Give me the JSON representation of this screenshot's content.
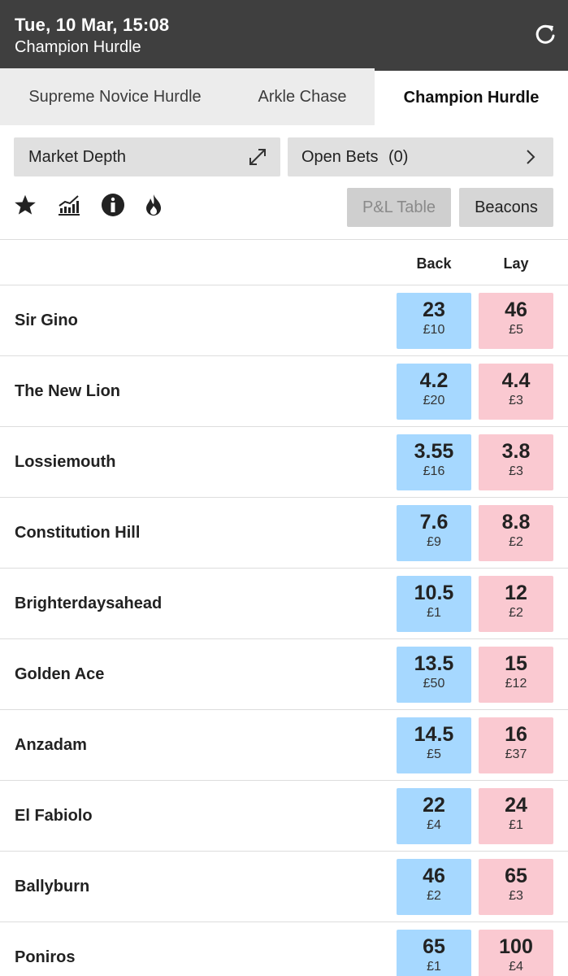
{
  "header": {
    "datetime": "Tue, 10 Mar, 15:08",
    "event": "Champion Hurdle",
    "refresh_icon": "refresh-icon"
  },
  "tabs": [
    {
      "label": "Supreme Novice Hurdle",
      "active": false
    },
    {
      "label": "Arkle Chase",
      "active": false
    },
    {
      "label": "Champion Hurdle",
      "active": true
    }
  ],
  "toolbar": {
    "market_depth": "Market Depth",
    "open_bets_label": "Open Bets",
    "open_bets_count": "(0)",
    "pl_table": "P&L Table",
    "beacons": "Beacons",
    "icons": [
      "star-icon",
      "chart-icon",
      "info-icon",
      "flame-icon"
    ]
  },
  "columns": {
    "back": "Back",
    "lay": "Lay"
  },
  "colors": {
    "header": "#3f3f3f",
    "back": "#a6d8ff",
    "lay": "#fac9d1"
  },
  "runners": [
    {
      "name": "Sir Gino",
      "back_odds": "23",
      "back_stake": "£10",
      "lay_odds": "46",
      "lay_stake": "£5"
    },
    {
      "name": "The New Lion",
      "back_odds": "4.2",
      "back_stake": "£20",
      "lay_odds": "4.4",
      "lay_stake": "£3"
    },
    {
      "name": "Lossiemouth",
      "back_odds": "3.55",
      "back_stake": "£16",
      "lay_odds": "3.8",
      "lay_stake": "£3"
    },
    {
      "name": "Constitution Hill",
      "back_odds": "7.6",
      "back_stake": "£9",
      "lay_odds": "8.8",
      "lay_stake": "£2"
    },
    {
      "name": "Brighterdaysahead",
      "back_odds": "10.5",
      "back_stake": "£1",
      "lay_odds": "12",
      "lay_stake": "£2"
    },
    {
      "name": "Golden Ace",
      "back_odds": "13.5",
      "back_stake": "£50",
      "lay_odds": "15",
      "lay_stake": "£12"
    },
    {
      "name": "Anzadam",
      "back_odds": "14.5",
      "back_stake": "£5",
      "lay_odds": "16",
      "lay_stake": "£37"
    },
    {
      "name": "El Fabiolo",
      "back_odds": "22",
      "back_stake": "£4",
      "lay_odds": "24",
      "lay_stake": "£1"
    },
    {
      "name": "Ballyburn",
      "back_odds": "46",
      "back_stake": "£2",
      "lay_odds": "65",
      "lay_stake": "£3"
    },
    {
      "name": "Poniros",
      "back_odds": "65",
      "back_stake": "£1",
      "lay_odds": "100",
      "lay_stake": "£4"
    }
  ]
}
